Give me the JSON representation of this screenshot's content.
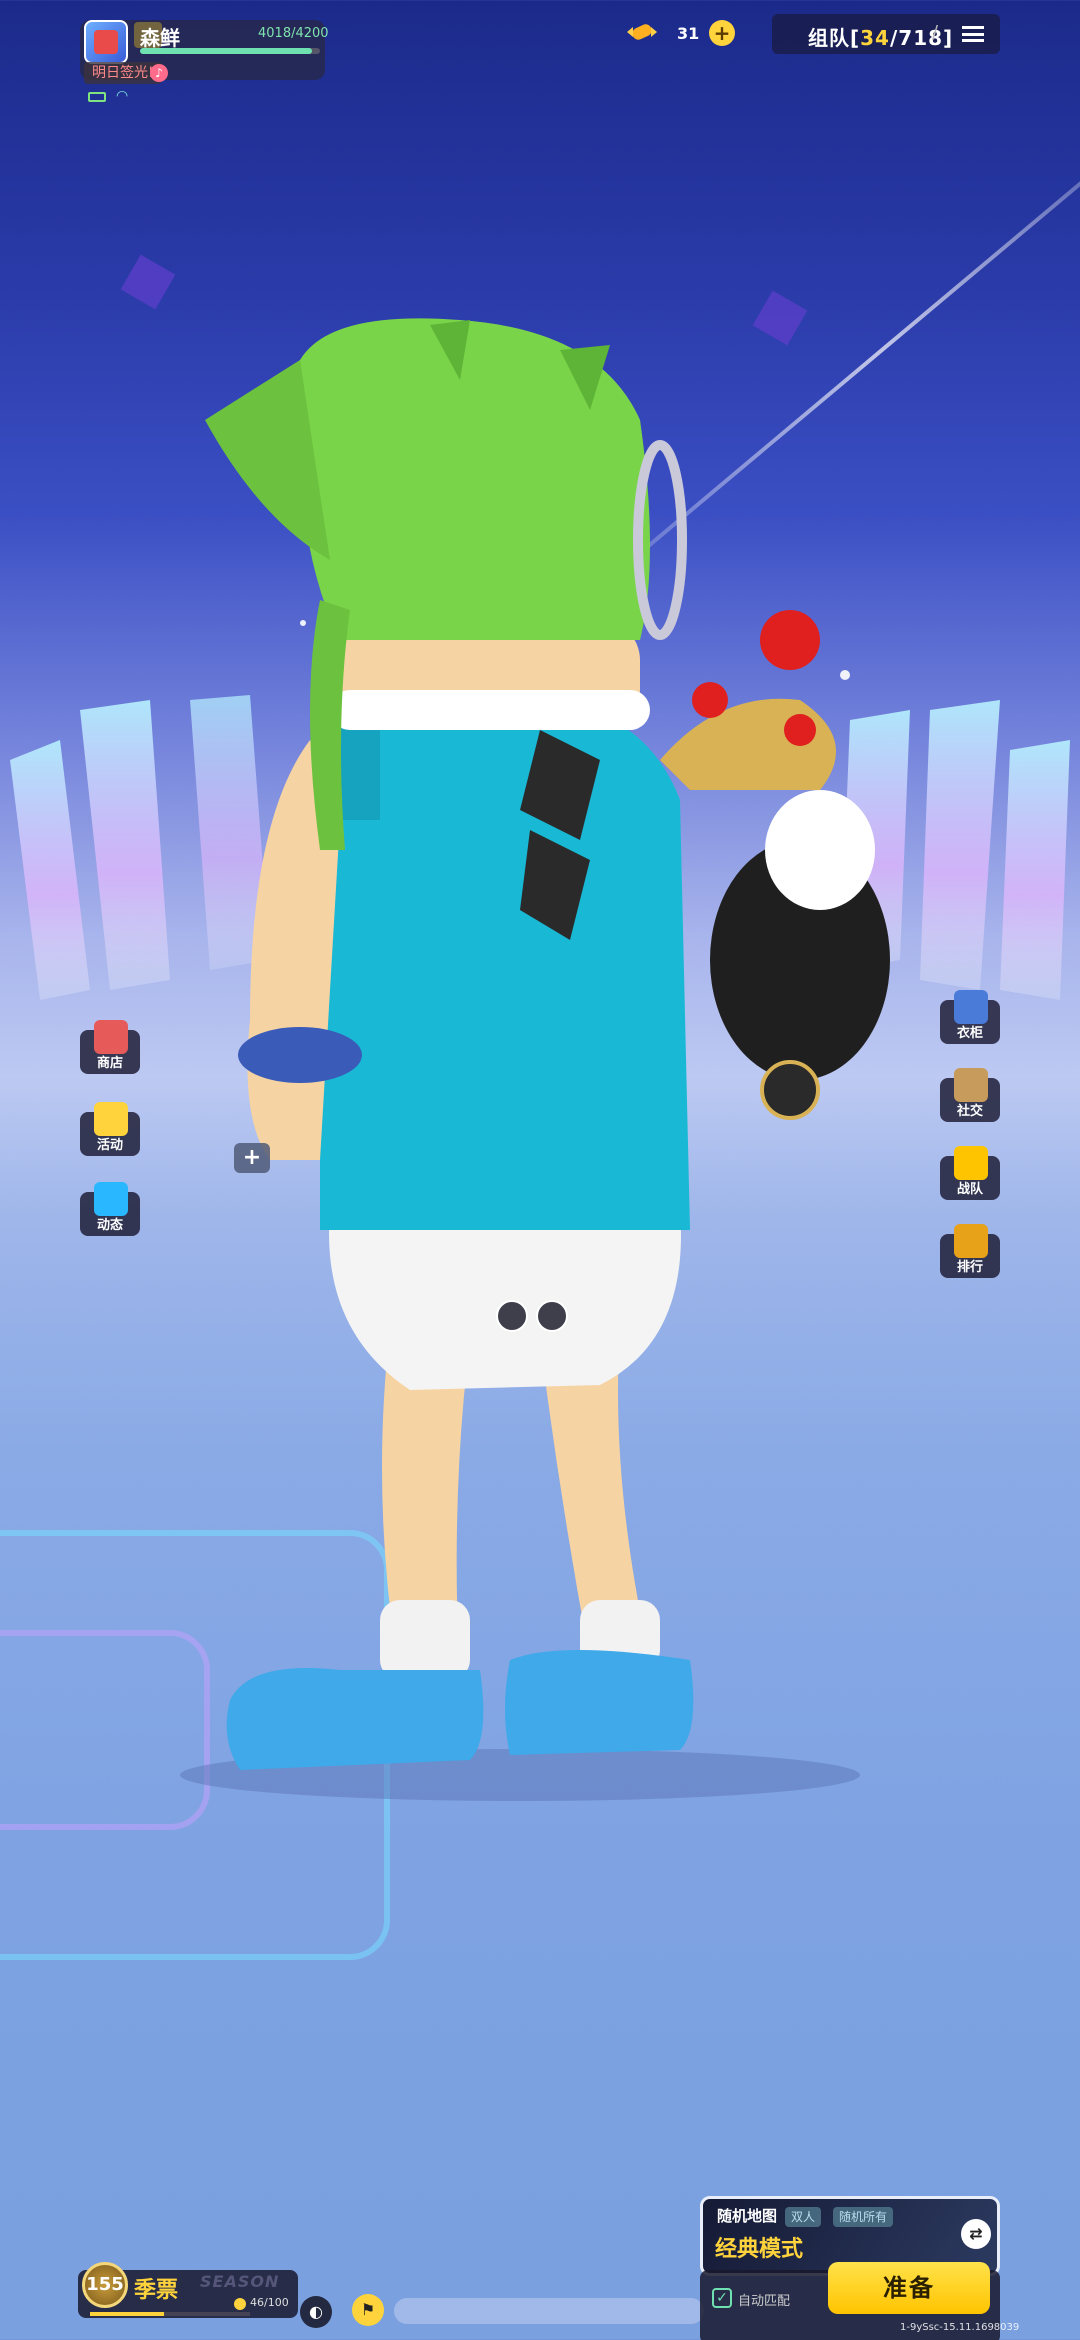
{
  "profile": {
    "nickname": "森鲜",
    "exp_text": "4018/4200",
    "exp_fraction": 0.957,
    "sub_badge": "明日签光!",
    "sub_dot": "♪"
  },
  "currency": {
    "candy_count": "31",
    "plus_label": "+"
  },
  "team": {
    "label_prefix": "组队[",
    "count": "34",
    "label_suffix": "/718]",
    "slash": "/"
  },
  "left_menu": [
    {
      "label": "商店",
      "icon": "shop-icon",
      "badge": "SHOP"
    },
    {
      "label": "活动",
      "icon": "activity-icon"
    },
    {
      "label": "动态",
      "icon": "tap-icon",
      "badge": "Tap"
    }
  ],
  "right_menu": [
    {
      "label": "衣柜",
      "icon": "wardrobe-icon"
    },
    {
      "label": "社交",
      "icon": "social-icon"
    },
    {
      "label": "战队",
      "icon": "squad-icon"
    },
    {
      "label": "排行",
      "icon": "ranking-icon"
    }
  ],
  "season": {
    "level": "155",
    "title": "季票",
    "watermark": "SEASON",
    "progress": "46/100",
    "progress_fraction": 0.46
  },
  "mode": {
    "title": "随机地图",
    "tag1": "双人",
    "tag2": "随机所有",
    "name": "经典模式"
  },
  "match": {
    "auto_label": "自动匹配",
    "ready_label": "准备"
  },
  "build_info": "1-9ySsc-15.11.1698039",
  "colors": {
    "accent": "#ffd33b",
    "panel": "#1e1e37",
    "exp": "#6fe0b0"
  }
}
